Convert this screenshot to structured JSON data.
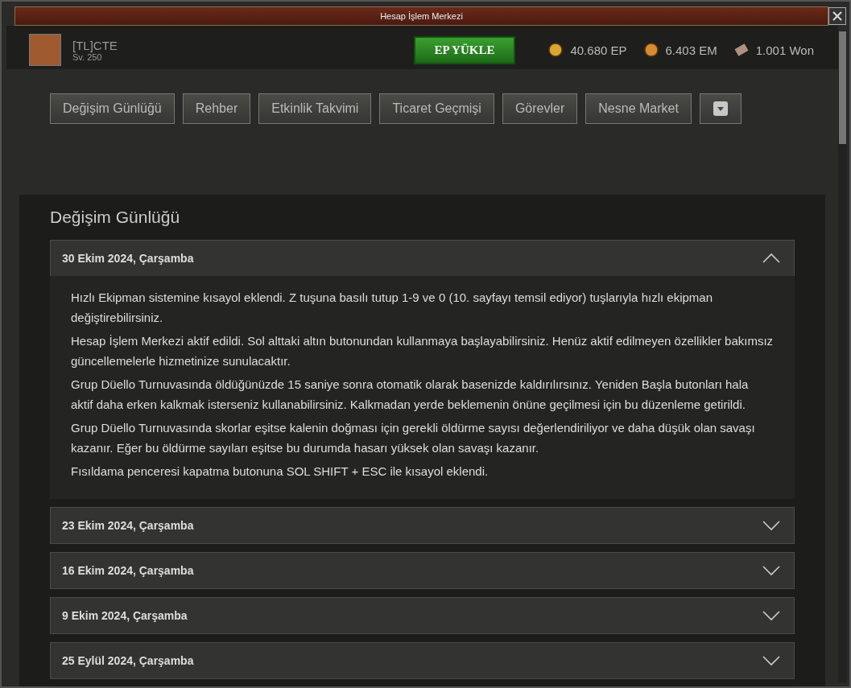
{
  "window": {
    "title": "Hesap İşlem Merkezi"
  },
  "player": {
    "name": "[TL]CTE",
    "level": "Sv. 250"
  },
  "load_button": "EP YÜKLE",
  "currencies": [
    {
      "kind": "ep",
      "amount": "40.680 EP"
    },
    {
      "kind": "em",
      "amount": "6.403 EM"
    },
    {
      "kind": "won",
      "amount": "1.001 Won"
    }
  ],
  "tabs": [
    {
      "label": "Değişim Günlüğü"
    },
    {
      "label": "Rehber"
    },
    {
      "label": "Etkinlik Takvimi"
    },
    {
      "label": "Ticaret Geçmişi"
    },
    {
      "label": "Görevler"
    },
    {
      "label": "Nesne Market"
    }
  ],
  "panel": {
    "title": "Değişim Günlüğü",
    "entries": [
      {
        "date": "30 Ekim 2024, Çarşamba",
        "expanded": true,
        "notes": [
          "Hızlı Ekipman sistemine kısayol eklendi. Z tuşuna basılı tutup 1-9 ve 0 (10. sayfayı temsil ediyor) tuşlarıyla hızlı ekipman değiştirebilirsiniz.",
          "Hesap İşlem Merkezi aktif edildi. Sol alttaki altın butonundan kullanmaya başlayabilirsiniz. Henüz aktif edilmeyen özellikler bakımsız güncellemelerle hizmetinize sunulacaktır.",
          "Grup Düello Turnuvasında öldüğünüzde 15 saniye sonra otomatik olarak basenizde kaldırılırsınız. Yeniden Başla butonları hala aktif daha erken kalkmak isterseniz kullanabilirsiniz. Kalkmadan yerde beklemenin önüne geçilmesi için bu düzenleme getirildi.",
          "Grup Düello Turnuvasında skorlar eşitse kalenin doğması için gerekli öldürme sayısı değerlendiriliyor ve daha düşük olan savaşı kazanır. Eğer bu öldürme sayıları eşitse bu durumda hasarı yüksek olan savaşı kazanır.",
          "Fısıldama penceresi kapatma butonuna SOL SHIFT + ESC ile kısayol eklendi."
        ]
      },
      {
        "date": "23 Ekim 2024, Çarşamba",
        "expanded": false
      },
      {
        "date": "16 Ekim 2024, Çarşamba",
        "expanded": false
      },
      {
        "date": "9 Ekim 2024, Çarşamba",
        "expanded": false
      },
      {
        "date": "25 Eylül 2024, Çarşamba",
        "expanded": false
      }
    ]
  }
}
